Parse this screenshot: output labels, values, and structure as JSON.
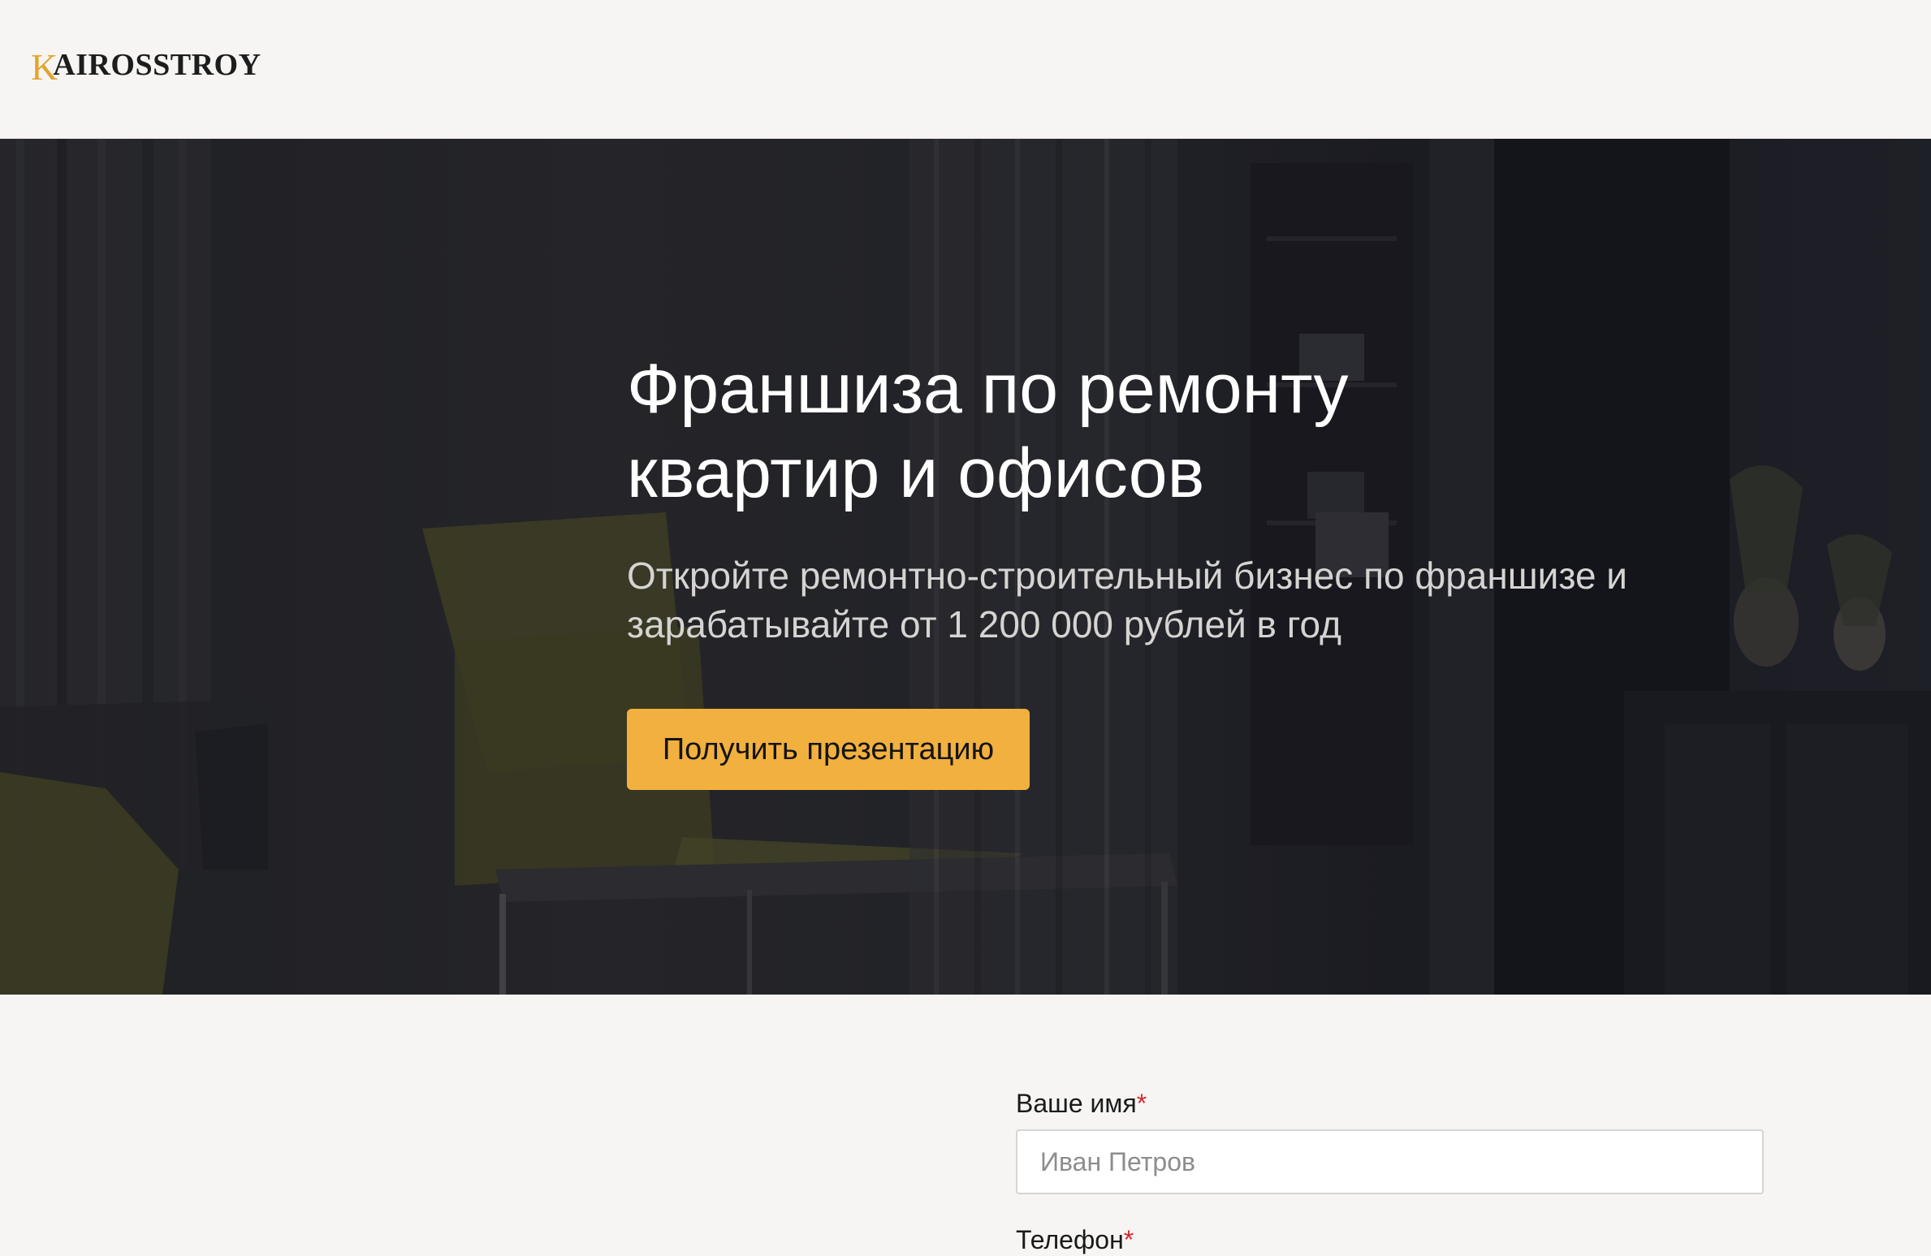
{
  "header": {
    "logo_initial": "K",
    "logo_text": "AIROSSTROY"
  },
  "hero": {
    "title": "Франшиза по ремонту квартир и офисов",
    "subtitle": "Откройте ремонтно-строительный бизнес по франшизе и зарабатывайте от 1 200 000 рублей в год",
    "cta_label": "Получить презентацию"
  },
  "form": {
    "name_label": "Ваше имя",
    "name_required_mark": "*",
    "name_placeholder": "Иван Петров",
    "phone_label": "Телефон",
    "phone_required_mark": "*"
  },
  "colors": {
    "accent": "#f2b03f",
    "logo_accent": "#e2a52c",
    "required": "#d8262c",
    "background": "#f6f5f4"
  }
}
